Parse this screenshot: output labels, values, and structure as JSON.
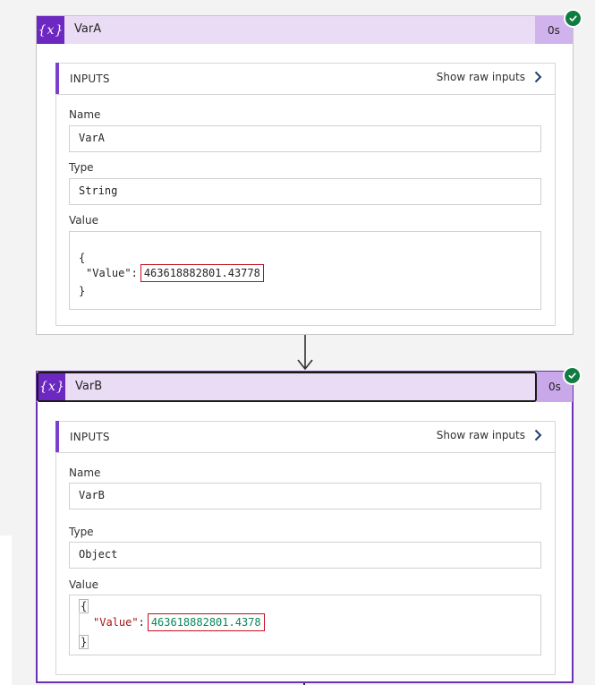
{
  "actions": [
    {
      "title": "VarA",
      "duration": "0s",
      "inputs_label": "INPUTS",
      "raw_link": "Show raw inputs",
      "name_label": "Name",
      "name_value": "VarA",
      "type_label": "Type",
      "type_value": "String",
      "value_label": "Value",
      "value_open": "{",
      "value_key": "\"Value\"",
      "value_colon": ":",
      "value_number": "463618882801.43778",
      "value_close": "}"
    },
    {
      "title": "VarB",
      "duration": "0s",
      "inputs_label": "INPUTS",
      "raw_link": "Show raw inputs",
      "name_label": "Name",
      "name_value": "VarB",
      "type_label": "Type",
      "type_value": "Object",
      "value_label": "Value",
      "value_open": "{",
      "value_key": "\"Value\"",
      "value_colon": ":",
      "value_number": "463618882801.4378",
      "value_close": "}"
    }
  ],
  "icon": {
    "variable": "{x}",
    "variable_name": "variable-icon",
    "success_name": "success-check-icon",
    "chevron_name": "chevron-right-icon",
    "arrow_name": "flow-arrow-icon"
  },
  "colors": {
    "accent": "#6d28c2",
    "header_bg": "#ebdcf6",
    "success": "#107c41",
    "highlight_border": "#c50f1f",
    "json_key": "#a31515",
    "json_number": "#098658"
  }
}
